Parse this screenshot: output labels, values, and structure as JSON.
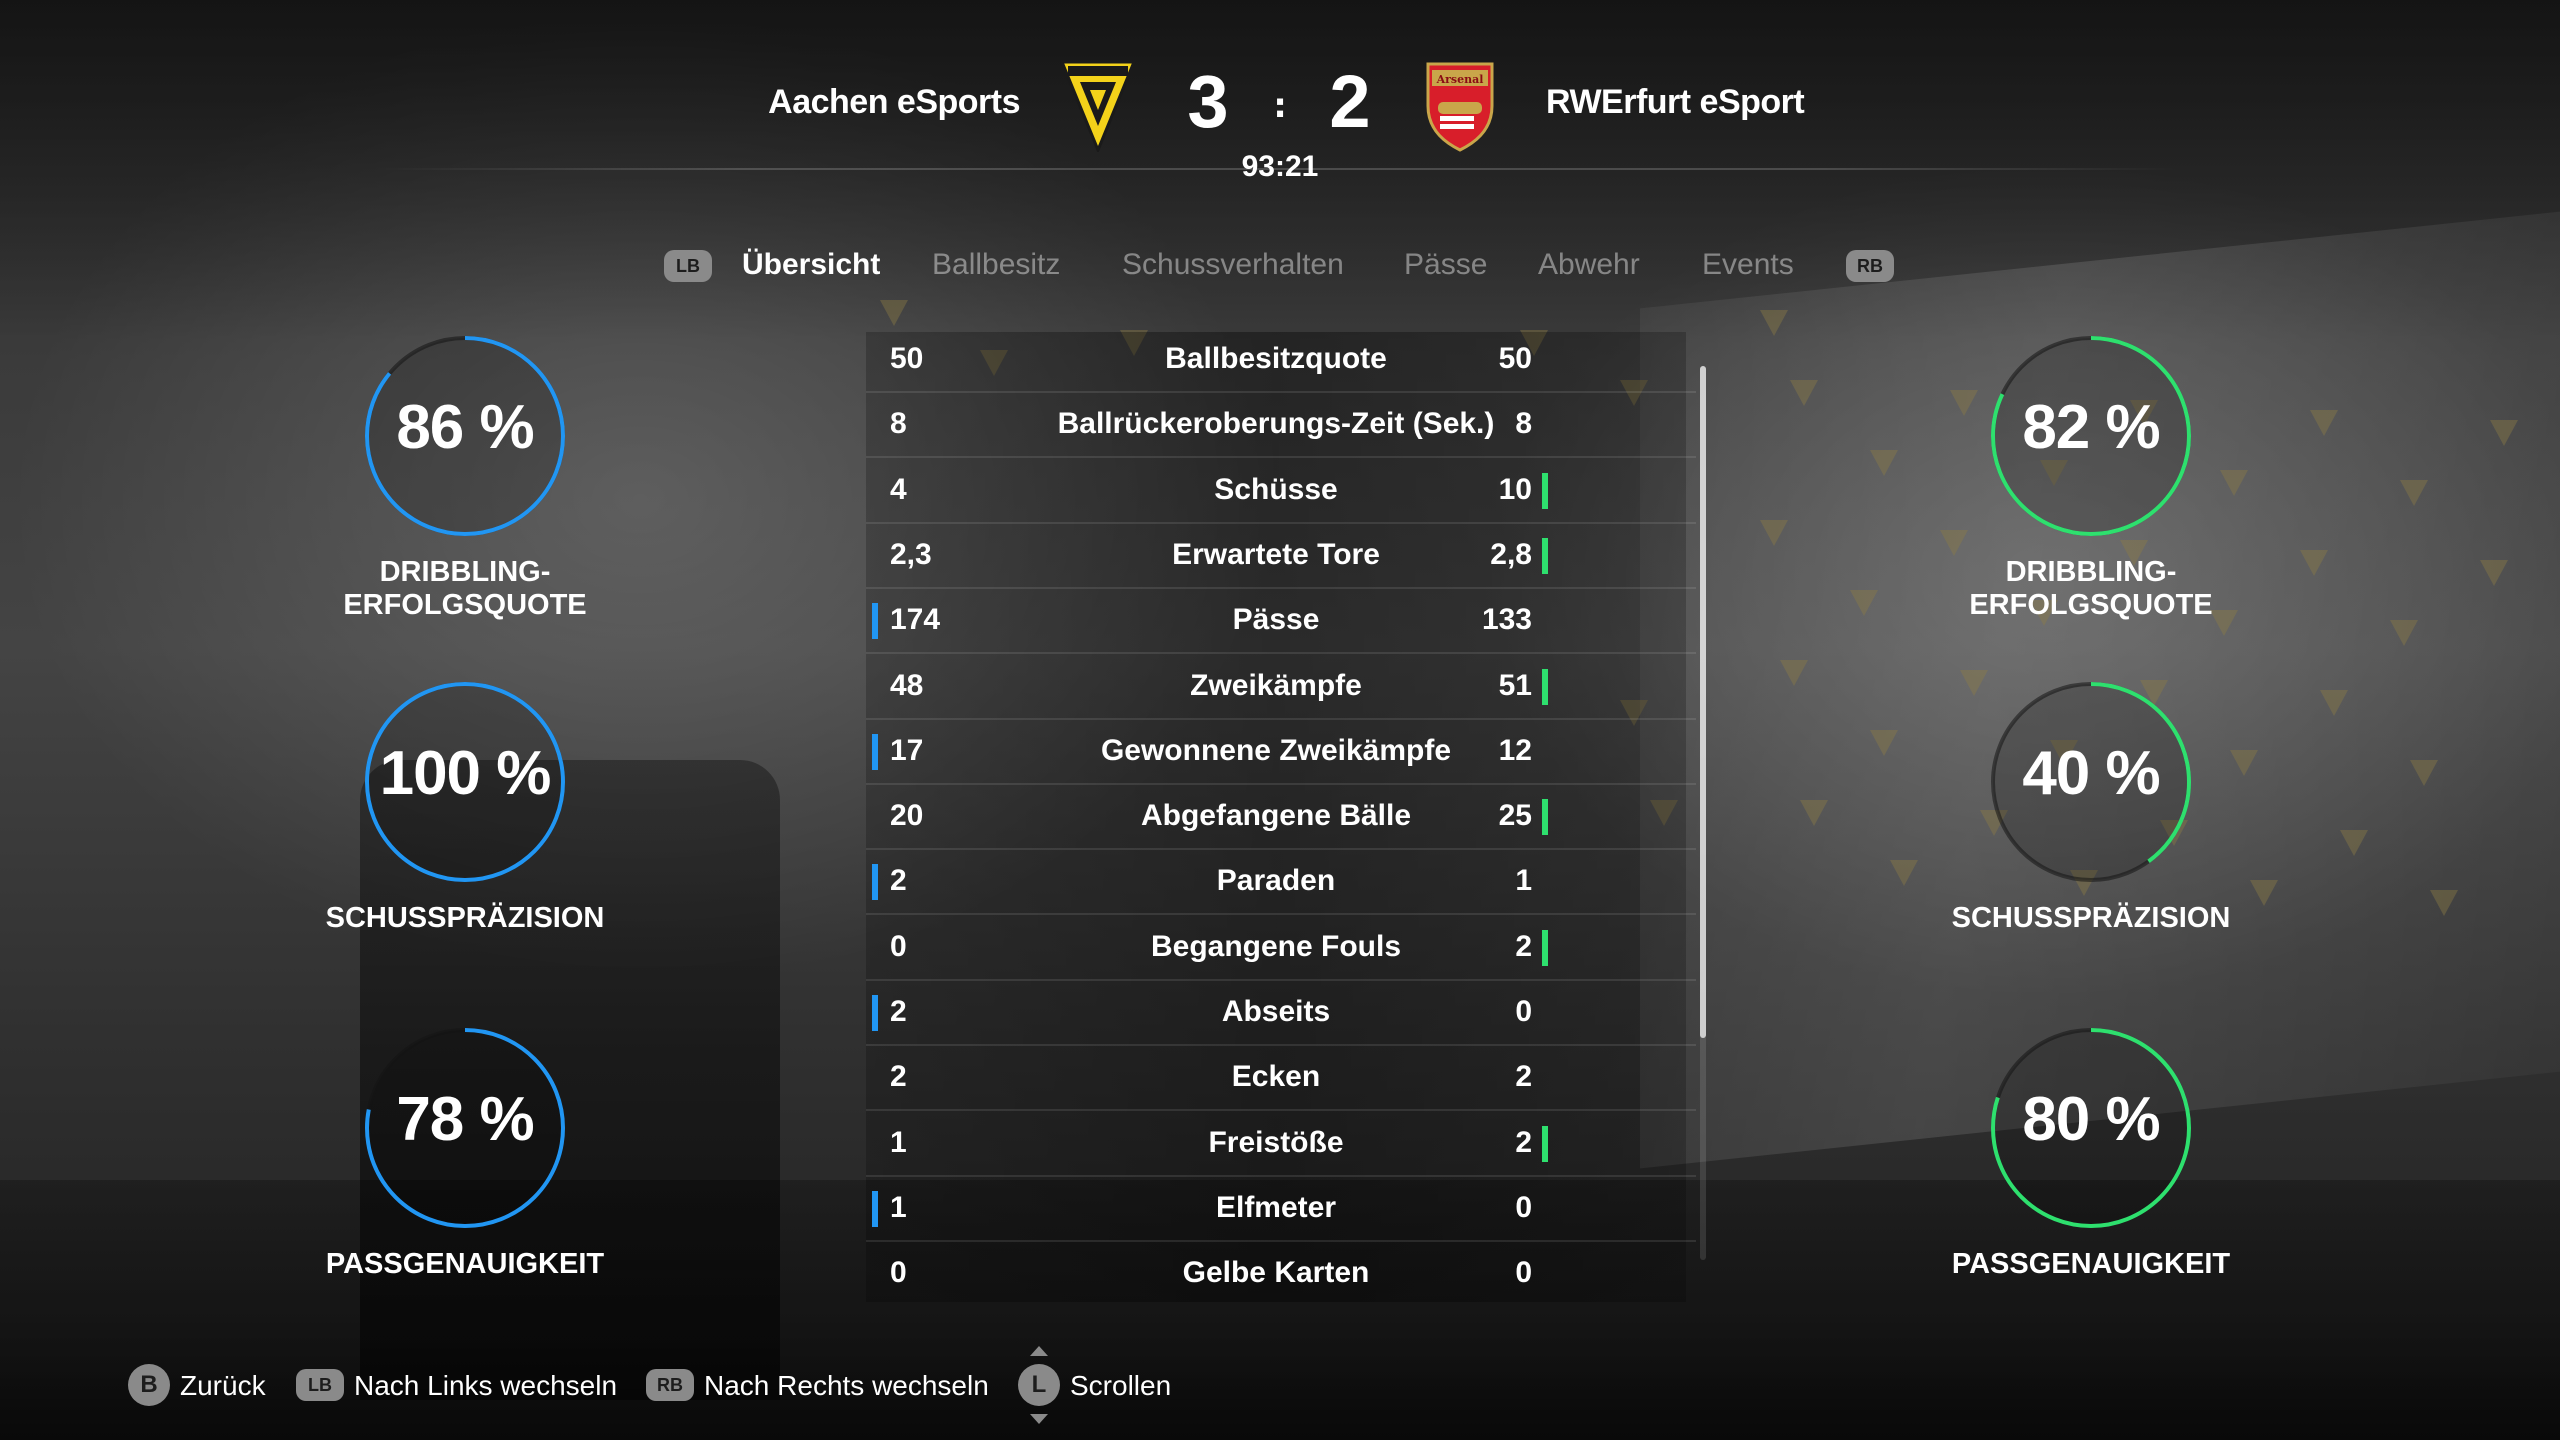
{
  "match": {
    "home_team": "Aachen eSports",
    "away_team": "RWErfurt eSport",
    "home_score": "3",
    "away_score": "2",
    "separator": ":",
    "time": "93:21",
    "away_crest_text": "Arsenal"
  },
  "tabs": {
    "lb": "LB",
    "rb": "RB",
    "items": [
      "Übersicht",
      "Ballbesitz",
      "Schussverhalten",
      "Pässe",
      "Abwehr",
      "Events"
    ],
    "active_index": 0
  },
  "gauges": {
    "home": [
      {
        "value": "86 %",
        "percent": 86,
        "label": "DRIBBLING-ERFOLGSQUOTE"
      },
      {
        "value": "100 %",
        "percent": 100,
        "label": "SCHUSSPRÄZISION"
      },
      {
        "value": "78 %",
        "percent": 78,
        "label": "PASSGENAUIGKEIT"
      }
    ],
    "away": [
      {
        "value": "82 %",
        "percent": 82,
        "label": "DRIBBLING-ERFOLGSQUOTE"
      },
      {
        "value": "40 %",
        "percent": 40,
        "label": "SCHUSSPRÄZISION"
      },
      {
        "value": "80 %",
        "percent": 80,
        "label": "PASSGENAUIGKEIT"
      }
    ],
    "home_color": "#2196f3",
    "away_color": "#2ee06e"
  },
  "stats": [
    {
      "name": "Ballbesitzquote",
      "home": "50",
      "away": "50",
      "leader": "none"
    },
    {
      "name": "Ballrückeroberungs-Zeit (Sek.)",
      "home": "8",
      "away": "8",
      "leader": "none"
    },
    {
      "name": "Schüsse",
      "home": "4",
      "away": "10",
      "leader": "away"
    },
    {
      "name": "Erwartete Tore",
      "home": "2,3",
      "away": "2,8",
      "leader": "away"
    },
    {
      "name": "Pässe",
      "home": "174",
      "away": "133",
      "leader": "home"
    },
    {
      "name": "Zweikämpfe",
      "home": "48",
      "away": "51",
      "leader": "away"
    },
    {
      "name": "Gewonnene Zweikämpfe",
      "home": "17",
      "away": "12",
      "leader": "home"
    },
    {
      "name": "Abgefangene Bälle",
      "home": "20",
      "away": "25",
      "leader": "away"
    },
    {
      "name": "Paraden",
      "home": "2",
      "away": "1",
      "leader": "home"
    },
    {
      "name": "Begangene Fouls",
      "home": "0",
      "away": "2",
      "leader": "away"
    },
    {
      "name": "Abseits",
      "home": "2",
      "away": "0",
      "leader": "home"
    },
    {
      "name": "Ecken",
      "home": "2",
      "away": "2",
      "leader": "none"
    },
    {
      "name": "Freistöße",
      "home": "1",
      "away": "2",
      "leader": "away"
    },
    {
      "name": "Elfmeter",
      "home": "1",
      "away": "0",
      "leader": "home"
    },
    {
      "name": "Gelbe Karten",
      "home": "0",
      "away": "0",
      "leader": "none"
    }
  ],
  "footer": {
    "back_btn": "B",
    "back_label": "Zurück",
    "lb_btn": "LB",
    "lb_label": "Nach Links wechseln",
    "rb_btn": "RB",
    "rb_label": "Nach Rechts wechseln",
    "scroll_btn": "L",
    "scroll_label": "Scrollen"
  }
}
